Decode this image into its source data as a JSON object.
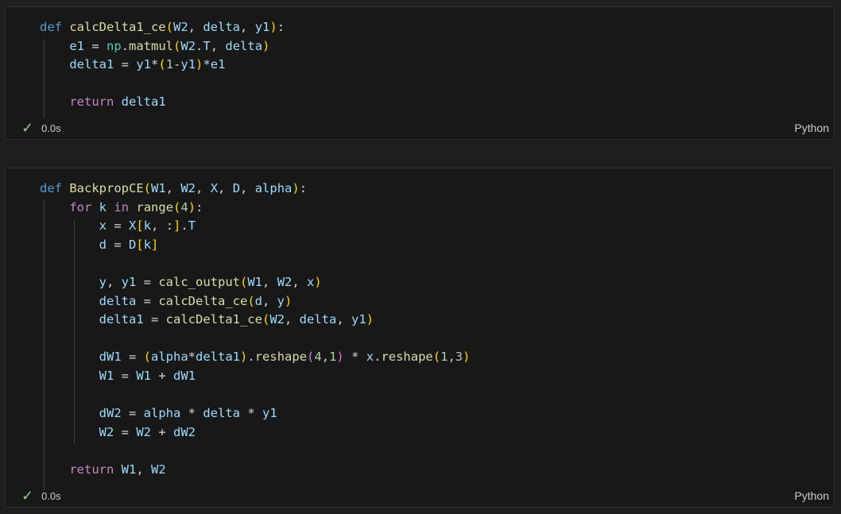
{
  "cells": [
    {
      "lines": [
        [
          [
            "kw",
            "def "
          ],
          [
            "fn",
            "calcDelta1_ce"
          ],
          [
            "br1",
            "("
          ],
          [
            "var",
            "W2"
          ],
          [
            "op",
            ", "
          ],
          [
            "var",
            "delta"
          ],
          [
            "op",
            ", "
          ],
          [
            "var",
            "y1"
          ],
          [
            "br1",
            ")"
          ],
          [
            "op",
            ":"
          ]
        ],
        [
          [
            "op",
            "    "
          ],
          [
            "var",
            "e1"
          ],
          [
            "op",
            " = "
          ],
          [
            "mod",
            "np"
          ],
          [
            "op",
            "."
          ],
          [
            "fn",
            "matmul"
          ],
          [
            "br1",
            "("
          ],
          [
            "var",
            "W2"
          ],
          [
            "op",
            "."
          ],
          [
            "var",
            "T"
          ],
          [
            "op",
            ", "
          ],
          [
            "var",
            "delta"
          ],
          [
            "br1",
            ")"
          ]
        ],
        [
          [
            "op",
            "    "
          ],
          [
            "var",
            "delta1"
          ],
          [
            "op",
            " = "
          ],
          [
            "var",
            "y1"
          ],
          [
            "op",
            "*"
          ],
          [
            "br1",
            "("
          ],
          [
            "num",
            "1"
          ],
          [
            "op",
            "-"
          ],
          [
            "var",
            "y1"
          ],
          [
            "br1",
            ")"
          ],
          [
            "op",
            "*"
          ],
          [
            "var",
            "e1"
          ]
        ],
        [],
        [
          [
            "op",
            "    "
          ],
          [
            "ctrl",
            "return"
          ],
          [
            "op",
            " "
          ],
          [
            "var",
            "delta1"
          ]
        ]
      ],
      "exec_time": "0.0s",
      "language": "Python"
    },
    {
      "lines": [
        [
          [
            "kw",
            "def "
          ],
          [
            "fn",
            "BackpropCE"
          ],
          [
            "br1",
            "("
          ],
          [
            "var",
            "W1"
          ],
          [
            "op",
            ", "
          ],
          [
            "var",
            "W2"
          ],
          [
            "op",
            ", "
          ],
          [
            "var",
            "X"
          ],
          [
            "op",
            ", "
          ],
          [
            "var",
            "D"
          ],
          [
            "op",
            ", "
          ],
          [
            "var",
            "alpha"
          ],
          [
            "br1",
            ")"
          ],
          [
            "op",
            ":"
          ]
        ],
        [
          [
            "op",
            "    "
          ],
          [
            "ctrl",
            "for"
          ],
          [
            "op",
            " "
          ],
          [
            "var",
            "k"
          ],
          [
            "op",
            " "
          ],
          [
            "ctrl",
            "in"
          ],
          [
            "op",
            " "
          ],
          [
            "fn",
            "range"
          ],
          [
            "br1",
            "("
          ],
          [
            "num",
            "4"
          ],
          [
            "br1",
            ")"
          ],
          [
            "op",
            ":"
          ]
        ],
        [
          [
            "op",
            "        "
          ],
          [
            "var",
            "x"
          ],
          [
            "op",
            " = "
          ],
          [
            "var",
            "X"
          ],
          [
            "br1",
            "["
          ],
          [
            "var",
            "k"
          ],
          [
            "op",
            ", :"
          ],
          [
            "br1",
            "]"
          ],
          [
            "op",
            "."
          ],
          [
            "var",
            "T"
          ]
        ],
        [
          [
            "op",
            "        "
          ],
          [
            "var",
            "d"
          ],
          [
            "op",
            " = "
          ],
          [
            "var",
            "D"
          ],
          [
            "br1",
            "["
          ],
          [
            "var",
            "k"
          ],
          [
            "br1",
            "]"
          ]
        ],
        [],
        [
          [
            "op",
            "        "
          ],
          [
            "var",
            "y"
          ],
          [
            "op",
            ", "
          ],
          [
            "var",
            "y1"
          ],
          [
            "op",
            " = "
          ],
          [
            "fn",
            "calc_output"
          ],
          [
            "br1",
            "("
          ],
          [
            "var",
            "W1"
          ],
          [
            "op",
            ", "
          ],
          [
            "var",
            "W2"
          ],
          [
            "op",
            ", "
          ],
          [
            "var",
            "x"
          ],
          [
            "br1",
            ")"
          ]
        ],
        [
          [
            "op",
            "        "
          ],
          [
            "var",
            "delta"
          ],
          [
            "op",
            " = "
          ],
          [
            "fn",
            "calcDelta_ce"
          ],
          [
            "br1",
            "("
          ],
          [
            "var",
            "d"
          ],
          [
            "op",
            ", "
          ],
          [
            "var",
            "y"
          ],
          [
            "br1",
            ")"
          ]
        ],
        [
          [
            "op",
            "        "
          ],
          [
            "var",
            "delta1"
          ],
          [
            "op",
            " = "
          ],
          [
            "fn",
            "calcDelta1_ce"
          ],
          [
            "br1",
            "("
          ],
          [
            "var",
            "W2"
          ],
          [
            "op",
            ", "
          ],
          [
            "var",
            "delta"
          ],
          [
            "op",
            ", "
          ],
          [
            "var",
            "y1"
          ],
          [
            "br1",
            ")"
          ]
        ],
        [],
        [
          [
            "op",
            "        "
          ],
          [
            "var",
            "dW1"
          ],
          [
            "op",
            " = "
          ],
          [
            "br1",
            "("
          ],
          [
            "var",
            "alpha"
          ],
          [
            "op",
            "*"
          ],
          [
            "var",
            "delta1"
          ],
          [
            "br1",
            ")"
          ],
          [
            "op",
            "."
          ],
          [
            "fn",
            "reshape"
          ],
          [
            "br2",
            "("
          ],
          [
            "num",
            "4"
          ],
          [
            "op",
            ","
          ],
          [
            "num",
            "1"
          ],
          [
            "br2",
            ")"
          ],
          [
            "op",
            " * "
          ],
          [
            "var",
            "x"
          ],
          [
            "op",
            "."
          ],
          [
            "fn",
            "reshape"
          ],
          [
            "br1",
            "("
          ],
          [
            "num",
            "1"
          ],
          [
            "op",
            ","
          ],
          [
            "num",
            "3"
          ],
          [
            "br1",
            ")"
          ]
        ],
        [
          [
            "op",
            "        "
          ],
          [
            "var",
            "W1"
          ],
          [
            "op",
            " = "
          ],
          [
            "var",
            "W1"
          ],
          [
            "op",
            " + "
          ],
          [
            "var",
            "dW1"
          ]
        ],
        [],
        [
          [
            "op",
            "        "
          ],
          [
            "var",
            "dW2"
          ],
          [
            "op",
            " = "
          ],
          [
            "var",
            "alpha"
          ],
          [
            "op",
            " * "
          ],
          [
            "var",
            "delta"
          ],
          [
            "op",
            " * "
          ],
          [
            "var",
            "y1"
          ]
        ],
        [
          [
            "op",
            "        "
          ],
          [
            "var",
            "W2"
          ],
          [
            "op",
            " = "
          ],
          [
            "var",
            "W2"
          ],
          [
            "op",
            " + "
          ],
          [
            "var",
            "dW2"
          ]
        ],
        [],
        [
          [
            "op",
            "    "
          ],
          [
            "ctrl",
            "return"
          ],
          [
            "op",
            " "
          ],
          [
            "var",
            "W1"
          ],
          [
            "op",
            ", "
          ],
          [
            "var",
            "W2"
          ]
        ]
      ],
      "exec_time": "0.0s",
      "language": "Python"
    }
  ]
}
